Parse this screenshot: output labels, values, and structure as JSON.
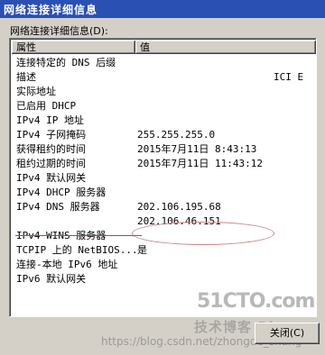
{
  "window": {
    "title": "网络连接详细信息"
  },
  "list_label": "网络连接详细信息(D):",
  "columns": {
    "property": "属性",
    "value": "值"
  },
  "rows": [
    {
      "property": "连接特定的 DNS 后缀",
      "value": ""
    },
    {
      "property": "描述",
      "value": "",
      "value_right": "ICI E"
    },
    {
      "property": "实际地址",
      "value": ""
    },
    {
      "property": "已启用 DHCP",
      "value": ""
    },
    {
      "property": "IPv4 IP 地址",
      "value": ""
    },
    {
      "property": "IPv4 子网掩码",
      "value": "255.255.255.0"
    },
    {
      "property": "获得租约的时间",
      "value": "2015年7月11日 8:43:13"
    },
    {
      "property": "租约过期的时间",
      "value": "2015年7月11日 11:43:12"
    },
    {
      "property": "IPv4 默认网关",
      "value": ""
    },
    {
      "property": "IPv4 DHCP 服务器",
      "value": ""
    },
    {
      "property": "IPv4 DNS 服务器",
      "value": "202.106.195.68"
    },
    {
      "property": "",
      "value": "202.106.46.151"
    },
    {
      "property": "IPv4 WINS 服务器",
      "value": ""
    },
    {
      "property": "TCPIP 上的 NetBIOS...",
      "value": "是"
    },
    {
      "property": "连接-本地 IPv6 地址",
      "value": ""
    },
    {
      "property": "IPv6 默认网关",
      "value": ""
    }
  ],
  "close_button": "关闭(C)",
  "watermark": {
    "logo": "51CTO.com",
    "sub": "技术博客 Blog",
    "url": "https://blog.csdn.net/zhongde_shang"
  }
}
